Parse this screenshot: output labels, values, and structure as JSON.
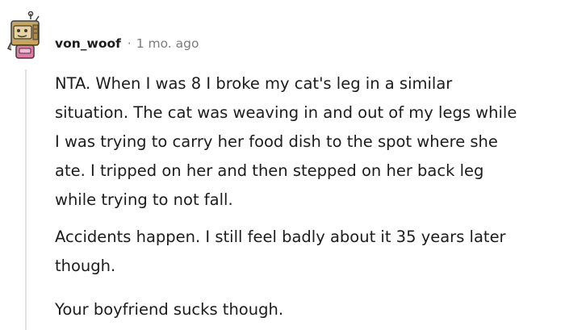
{
  "comment": {
    "author": "von_woof",
    "separator": "·",
    "timestamp": "1 mo. ago",
    "avatar_icon": "robot-box-avatar-icon",
    "paragraphs": [
      "NTA. When I was 8 I broke my cat's leg in a similar\nsituation. The cat was weaving in and out of my legs while\nI was trying to carry her food dish to the spot where she\nate. I tripped on her and then stepped on her back leg\nwhile trying to not fall.",
      "Accidents happen. I still feel badly about it 35 years later\nthough.",
      "Your boyfriend sucks though."
    ]
  },
  "colors": {
    "text": "#1c1c1c",
    "meta": "#7c7c7c",
    "thread_line": "#e0e0e0",
    "avatar_body": "#c9a45c",
    "avatar_accent": "#e07aa8"
  }
}
